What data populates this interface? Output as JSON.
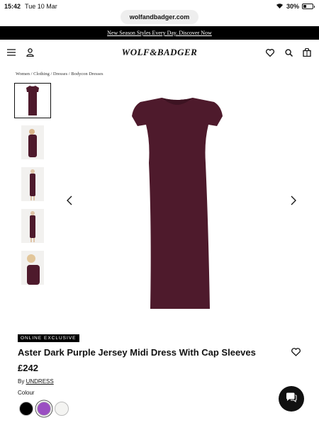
{
  "status_bar": {
    "time": "15:42",
    "date": "Tue 10 Mar",
    "battery": "30%"
  },
  "browser": {
    "url": "wolfandbadger.com"
  },
  "promo": {
    "text": "New Season Styles Every Day. Discover Now"
  },
  "header": {
    "logo": "WOLF&BADGER"
  },
  "breadcrumb": "Women / Clothing / Dresses / Bodycon Dresses",
  "product": {
    "badge": "ONLINE EXCLUSIVE",
    "title": "Aster Dark Purple Jersey Midi Dress With Cap Sleeves",
    "price": "£242",
    "brand_prefix": "By",
    "brand": "UNDRESS",
    "colour_label": "Colour",
    "colours": [
      "#000000",
      "#9b4fc2",
      "#f4f4f2"
    ],
    "dress_color": "#4e1a2c"
  },
  "icons": {
    "menu": "menu-icon",
    "account": "user-icon",
    "wishlist": "heart-icon",
    "search": "search-icon",
    "bag": "bag-icon",
    "chat": "chat-icon",
    "prev": "chevron-left-icon",
    "next": "chevron-right-icon"
  }
}
